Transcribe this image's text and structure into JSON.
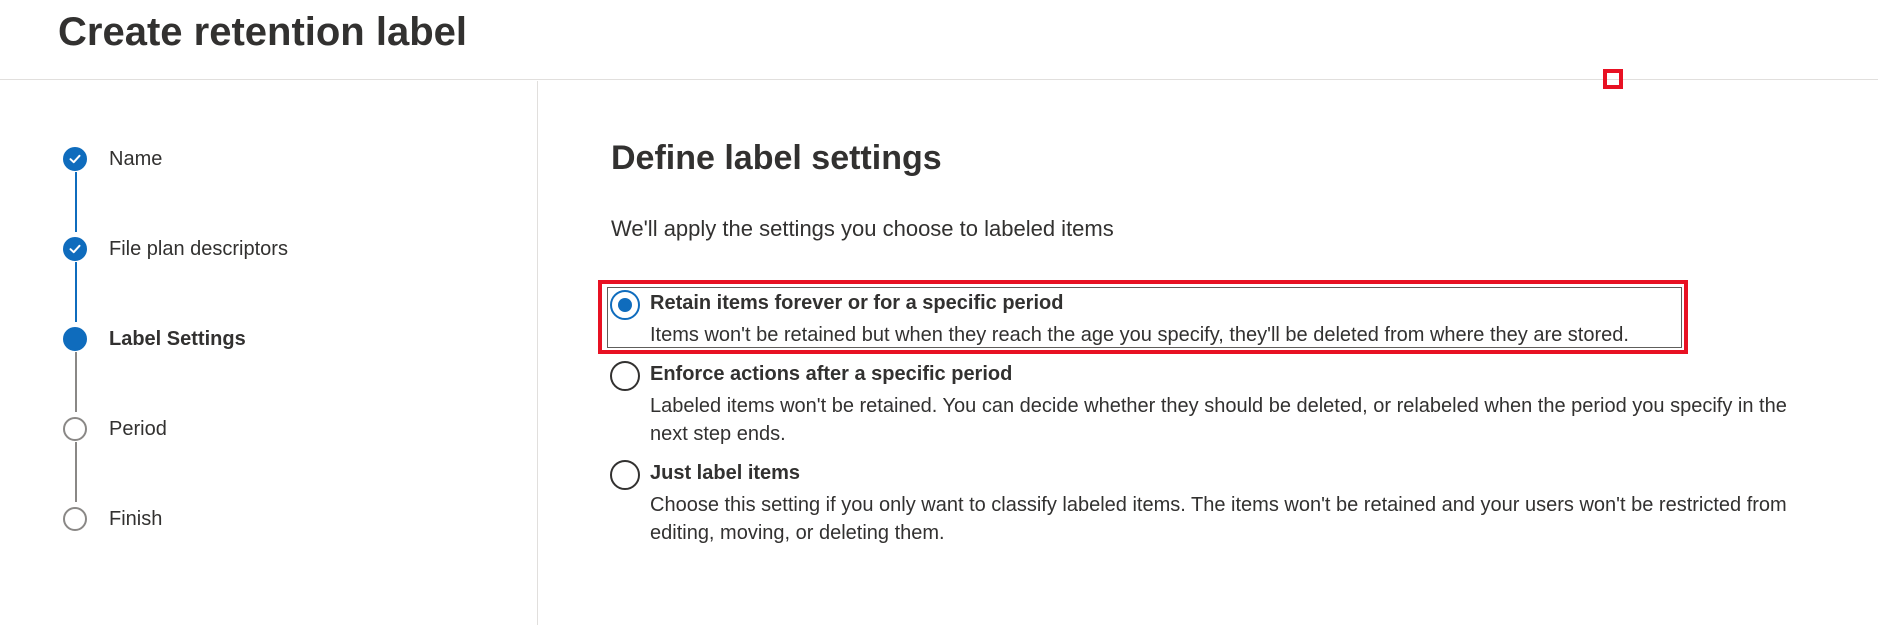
{
  "header": {
    "title": "Create retention label"
  },
  "wizard": {
    "steps": [
      {
        "label": "Name",
        "status": "done"
      },
      {
        "label": "File plan descriptors",
        "status": "done"
      },
      {
        "label": "Label Settings",
        "status": "current"
      },
      {
        "label": "Period",
        "status": "todo"
      },
      {
        "label": "Finish",
        "status": "todo"
      }
    ]
  },
  "main": {
    "title": "Define label settings",
    "description": "We'll apply the settings you choose to labeled items",
    "options": [
      {
        "title": "Retain items forever or for a specific period",
        "description": "Items won't be retained but when they reach the age you specify, they'll be deleted from where they are stored.",
        "selected": true
      },
      {
        "title": "Enforce actions after a specific period",
        "description": "Labeled items won't be retained. You can decide whether they should be deleted, or relabeled when the period you specify in the next step ends.",
        "selected": false
      },
      {
        "title": "Just label items",
        "description": "Choose this setting if you only want to classify labeled items. The items won't be retained and your users won't be restricted from editing, moving, or deleting them.",
        "selected": false
      }
    ]
  },
  "icons": {
    "step_done": "checkmark-icon",
    "step_current": "filled-circle-icon",
    "step_todo": "empty-circle-icon"
  },
  "colors": {
    "accent": "#0f6cbd",
    "highlight": "#e81123",
    "pending": "#8a8886",
    "text": "#323130"
  }
}
